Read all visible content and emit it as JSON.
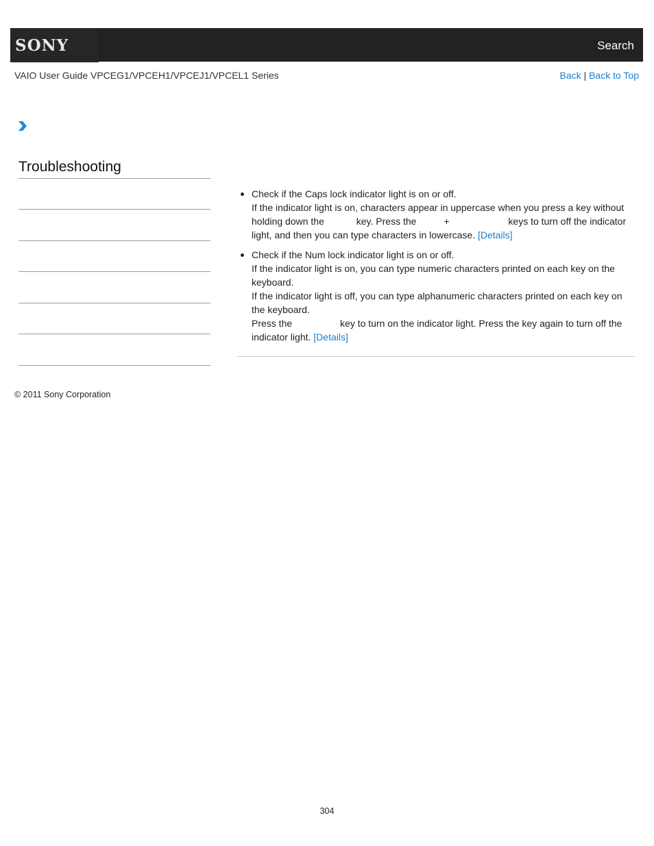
{
  "header": {
    "logo": "SONY",
    "search_label": "Search"
  },
  "subheader": {
    "guide_title": "VAIO User Guide VPCEG1/VPCEH1/VPCEJ1/VPCEL1 Series",
    "back_label": "Back",
    "separator": "|",
    "back_to_top_label": "Back to Top"
  },
  "breadcrumb": {
    "icon": "chevron-right-icon"
  },
  "sidebar": {
    "title": "Troubleshooting",
    "items": [
      "",
      "",
      "",
      "",
      "",
      ""
    ]
  },
  "content": {
    "items": [
      {
        "heading": "Check if the Caps lock indicator light is on or off.",
        "text_1": "If the indicator light is on, characters appear in uppercase when you press a key without holding down the",
        "text_2": "key. Press the",
        "text_3": "+",
        "text_4": "keys to turn off the indicator light, and then you can type characters in lowercase.",
        "link": "[Details]"
      },
      {
        "heading": "Check if the Num lock indicator light is on or off.",
        "text_1": "If the indicator light is on, you can type numeric characters printed on each key on the keyboard.",
        "text_2": "If the indicator light is off, you can type alphanumeric characters printed on each key on the keyboard.",
        "text_3": "Press the",
        "text_4": "key to turn on the indicator light. Press the key again to turn off the indicator light.",
        "link": "[Details]"
      }
    ]
  },
  "footer": {
    "copyright": "© 2011 Sony Corporation",
    "page_number": "304"
  },
  "colors": {
    "header_bg": "#222222",
    "link": "#1a7fd0",
    "chevron": "#1f8ad6"
  }
}
